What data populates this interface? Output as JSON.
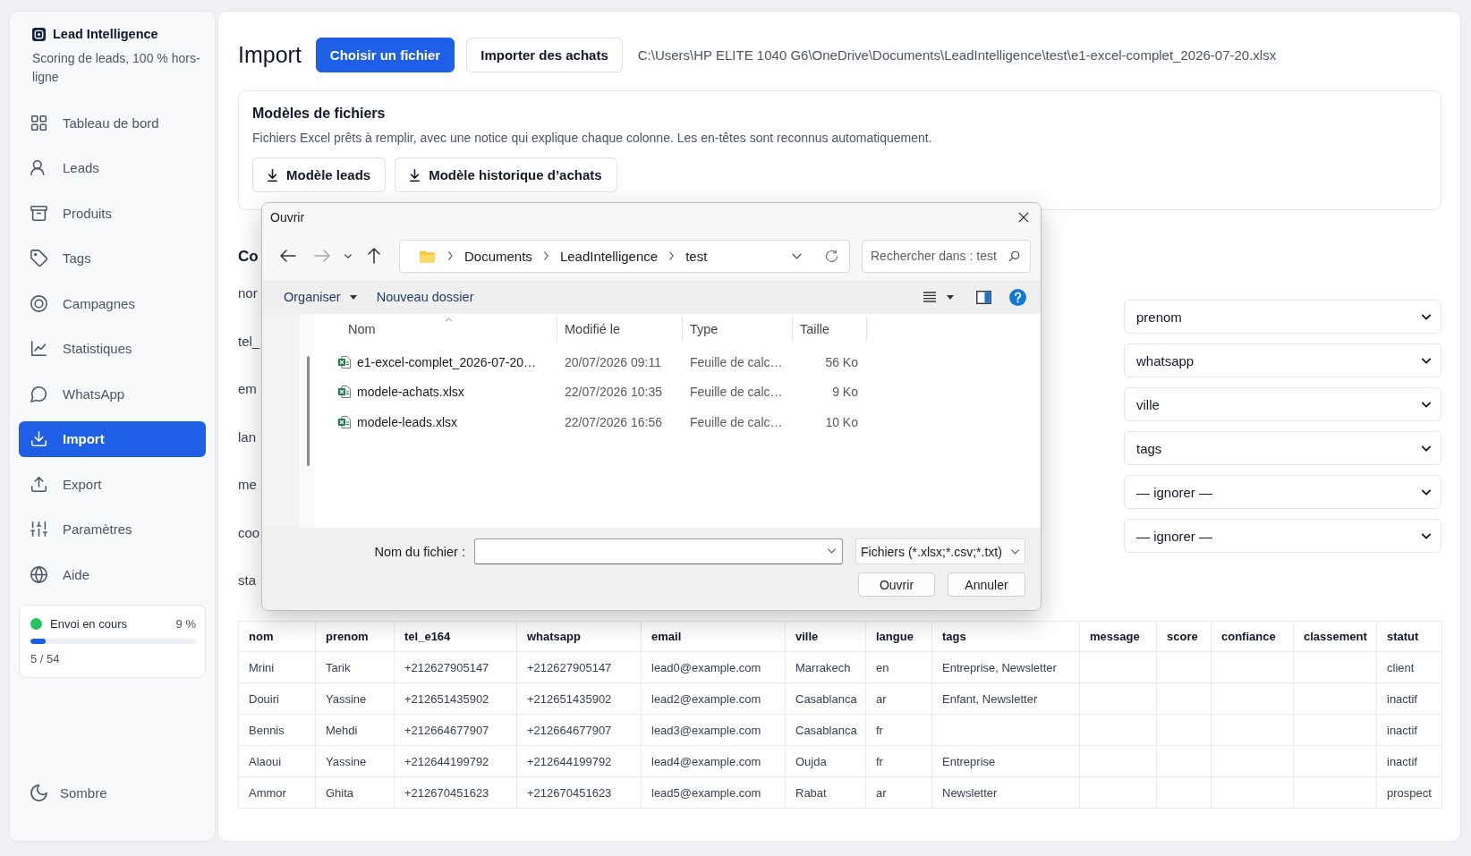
{
  "sidebar": {
    "brand": {
      "title": "Lead Intelligence",
      "subtitle": "Scoring de leads, 100 % hors-ligne"
    },
    "items": [
      {
        "label": "Tableau de bord",
        "selected": false
      },
      {
        "label": "Leads",
        "selected": false
      },
      {
        "label": "Produits",
        "selected": false
      },
      {
        "label": "Tags",
        "selected": false
      },
      {
        "label": "Campagnes",
        "selected": false
      },
      {
        "label": "Statistiques",
        "selected": false
      },
      {
        "label": "WhatsApp",
        "selected": false
      },
      {
        "label": "Import",
        "selected": true
      },
      {
        "label": "Export",
        "selected": false
      },
      {
        "label": "Paramètres",
        "selected": false
      },
      {
        "label": "Aide",
        "selected": false
      }
    ],
    "job": {
      "label": "Envoi en cours",
      "percent": "9 %",
      "level": 0.09,
      "count": "5 / 54"
    },
    "theme_toggle": {
      "label": "Sombre"
    }
  },
  "header": {
    "title": "Import",
    "buttons": [
      {
        "label": "Choisir un fichier",
        "kind": "primary"
      },
      {
        "label": "Importer des achats",
        "kind": "secondary"
      }
    ],
    "file_path": "C:\\Users\\HP ELITE 1040 G6\\OneDrive\\Documents\\LeadIntelligence\\test\\e1-excel-complet_2026-07-20.xlsx"
  },
  "templates": {
    "title": "Modèles de fichiers",
    "description": "Fichiers Excel prêts à remplir, avec une notice qui explique chaque colonne. Les en-têtes sont reconnus automatiquement.",
    "buttons": [
      "Modèle leads",
      "Modèle historique d’achats"
    ]
  },
  "mapping": {
    "heading": "Co",
    "source_columns": [
      "nor",
      "tel_",
      "em",
      "lan",
      "me",
      "coo",
      "sta"
    ],
    "targets": [
      "prenom",
      "whatsapp",
      "ville",
      "tags",
      "— ignorer —",
      "— ignorer —"
    ]
  },
  "preview_table": {
    "columns": [
      "nom",
      "prenom",
      "tel_e164",
      "whatsapp",
      "email",
      "ville",
      "langue",
      "tags",
      "message",
      "score",
      "confiance",
      "classement",
      "statut"
    ],
    "rows": [
      [
        "Mrini",
        "Tarik",
        "+212627905147",
        "+212627905147",
        "lead0@example.com",
        "Marrakech",
        "en",
        "Entreprise, Newsletter",
        null,
        null,
        null,
        null,
        "client"
      ],
      [
        "Douiri",
        "Yassine",
        "+212651435902",
        "+212651435902",
        "lead2@example.com",
        "Casablanca",
        "ar",
        "Enfant, Newsletter",
        null,
        null,
        null,
        null,
        "inactif"
      ],
      [
        "Bennis",
        "Mehdi",
        "+212664677907",
        "+212664677907",
        "lead3@example.com",
        "Casablanca",
        "fr",
        null,
        null,
        null,
        null,
        null,
        "inactif"
      ],
      [
        "Alaoui",
        "Yassine",
        "+212644199792",
        "+212644199792",
        "lead4@example.com",
        "Oujda",
        "fr",
        "Entreprise",
        null,
        null,
        null,
        null,
        "inactif"
      ],
      [
        "Ammor",
        "Ghita",
        "+212670451623",
        "+212670451623",
        "lead5@example.com",
        "Rabat",
        "ar",
        "Newsletter",
        null,
        null,
        null,
        null,
        "prospect"
      ]
    ]
  },
  "dialog": {
    "title": "Ouvrir",
    "nav": [
      {
        "kind": "back",
        "disabled": false
      },
      {
        "kind": "forward",
        "disabled": true
      },
      {
        "kind": "recent",
        "disabled": false
      },
      {
        "kind": "up",
        "disabled": false
      }
    ],
    "breadcrumb": [
      "Documents",
      "LeadIntelligence",
      "test"
    ],
    "search": {
      "placeholder": "Rechercher dans : test"
    },
    "commands": [
      {
        "label": "Organiser",
        "kind": "menu"
      },
      {
        "label": "Nouveau dossier",
        "kind": "plain"
      }
    ],
    "columns": [
      {
        "label": "Nom",
        "sorted": true
      },
      {
        "label": "Modifié le",
        "sorted": false
      },
      {
        "label": "Type",
        "sorted": false
      },
      {
        "label": "Taille",
        "sorted": false
      }
    ],
    "files": [
      {
        "name": "e1-excel-complet_2026-07-20…",
        "modified": "20/07/2026 09:11",
        "type": "Feuille de calc…",
        "size": "56 Ko",
        "selected": false
      },
      {
        "name": "modele-achats.xlsx",
        "modified": "22/07/2026 10:35",
        "type": "Feuille de calc…",
        "size": "9 Ko",
        "selected": false
      },
      {
        "name": "modele-leads.xlsx",
        "modified": "22/07/2026 16:56",
        "type": "Feuille de calc…",
        "size": "10 Ko",
        "selected": false
      }
    ],
    "filename": {
      "label": "Nom du fichier :"
    },
    "filter": "Fichiers (*.xlsx;*.csv;*.txt)",
    "buttons": [
      "Ouvrir",
      "Annuler"
    ]
  }
}
